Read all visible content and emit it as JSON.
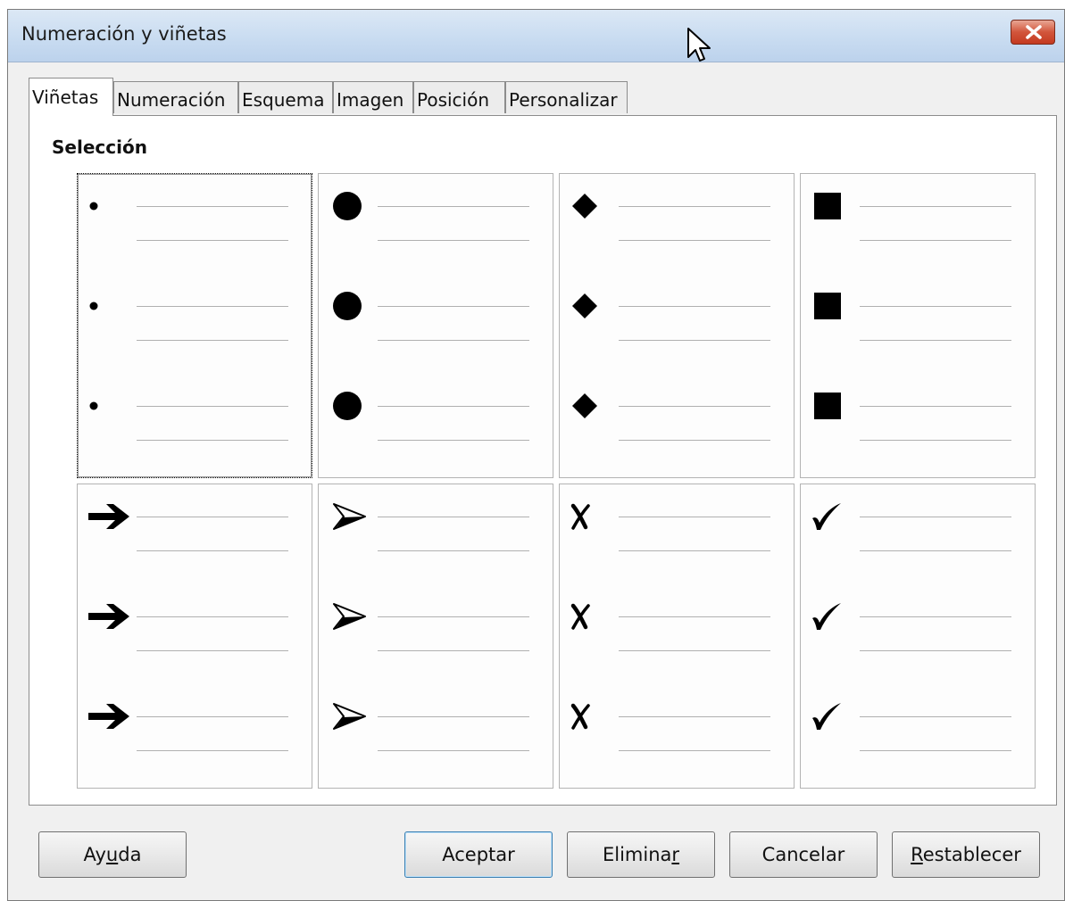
{
  "window": {
    "title": "Numeración y viñetas"
  },
  "tabs": [
    {
      "label": "Viñetas",
      "active": true
    },
    {
      "label": "Numeración",
      "active": false
    },
    {
      "label": "Esquema",
      "active": false
    },
    {
      "label": "Imagen",
      "active": false
    },
    {
      "label": "Posición",
      "active": false
    },
    {
      "label": "Personalizar",
      "active": false
    }
  ],
  "selection": {
    "label": "Selección",
    "options": [
      {
        "bullet": "small-dot",
        "selected": true
      },
      {
        "bullet": "large-circle",
        "selected": false
      },
      {
        "bullet": "diamond",
        "selected": false
      },
      {
        "bullet": "square",
        "selected": false
      },
      {
        "bullet": "arrow-right",
        "selected": false
      },
      {
        "bullet": "arrowhead-outline",
        "selected": false
      },
      {
        "bullet": "x-mark",
        "selected": false
      },
      {
        "bullet": "check-mark",
        "selected": false
      }
    ]
  },
  "buttons": {
    "help": {
      "pre": "Ay",
      "key": "u",
      "post": "da"
    },
    "ok": {
      "pre": "Aceptar",
      "key": "",
      "post": ""
    },
    "delete": {
      "pre": "Elimina",
      "key": "r",
      "post": ""
    },
    "cancel": {
      "pre": "Cancelar",
      "key": "",
      "post": ""
    },
    "reset": {
      "pre": "",
      "key": "R",
      "post": "establecer"
    }
  }
}
